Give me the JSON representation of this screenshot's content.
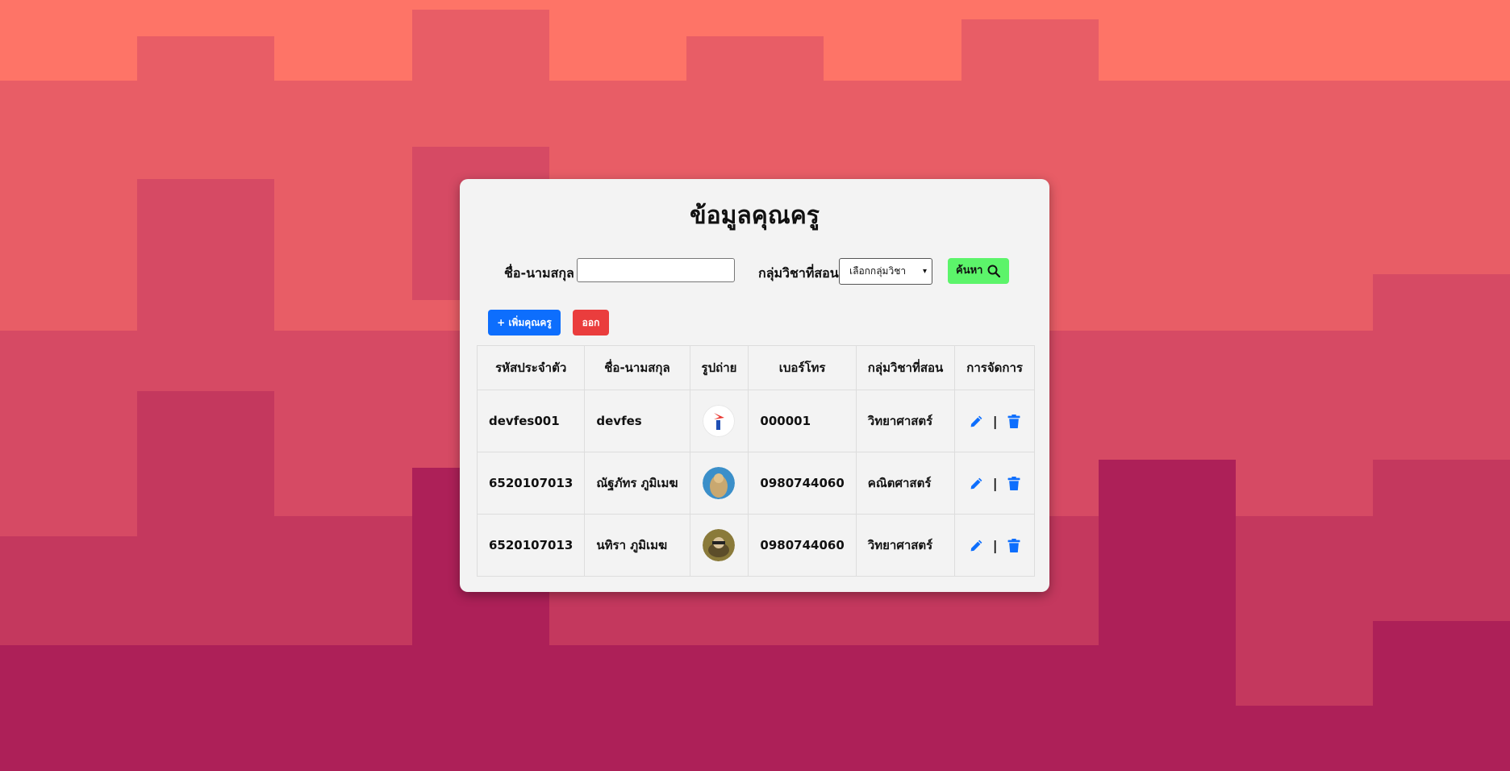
{
  "page": {
    "title": "ข้อมูลคุณครู"
  },
  "search": {
    "name_label": "ชื่อ-นามสกุล",
    "name_value": "",
    "subject_label": "กลุ่มวิชาที่สอน",
    "subject_selected": "เลือกกลุ่มวิชา",
    "search_button": "ค้นหา"
  },
  "actions": {
    "add_label": "+ เพิ่มคุณครู",
    "logout_label": "ออก"
  },
  "table": {
    "columns": [
      "รหัสประจำตัว",
      "ชื่อ-นามสกุล",
      "รูปถ่าย",
      "เบอร์โทร",
      "กลุ่มวิชาที่สอน",
      "การจัดการ"
    ],
    "rows": [
      {
        "id": "devfes001",
        "name": "devfes",
        "phone": "000001",
        "subject": "วิทยาศาสตร์"
      },
      {
        "id": "6520107013",
        "name": "ณัฐภัทร ภูมิเมฆ",
        "phone": "0980744060",
        "subject": "คณิตศาสตร์"
      },
      {
        "id": "6520107013",
        "name": "นทิรา ภูมิเมฆ",
        "phone": "0980744060",
        "subject": "วิทยาศาสตร์"
      }
    ],
    "action_separator": "|"
  },
  "colors": {
    "add_button": "#0d6efd",
    "logout_button": "#ea3d3d",
    "search_button": "#5cf46a",
    "action_icons": "#0d6efd"
  },
  "icons": [
    "search-icon",
    "pencil-icon",
    "trash-icon"
  ]
}
